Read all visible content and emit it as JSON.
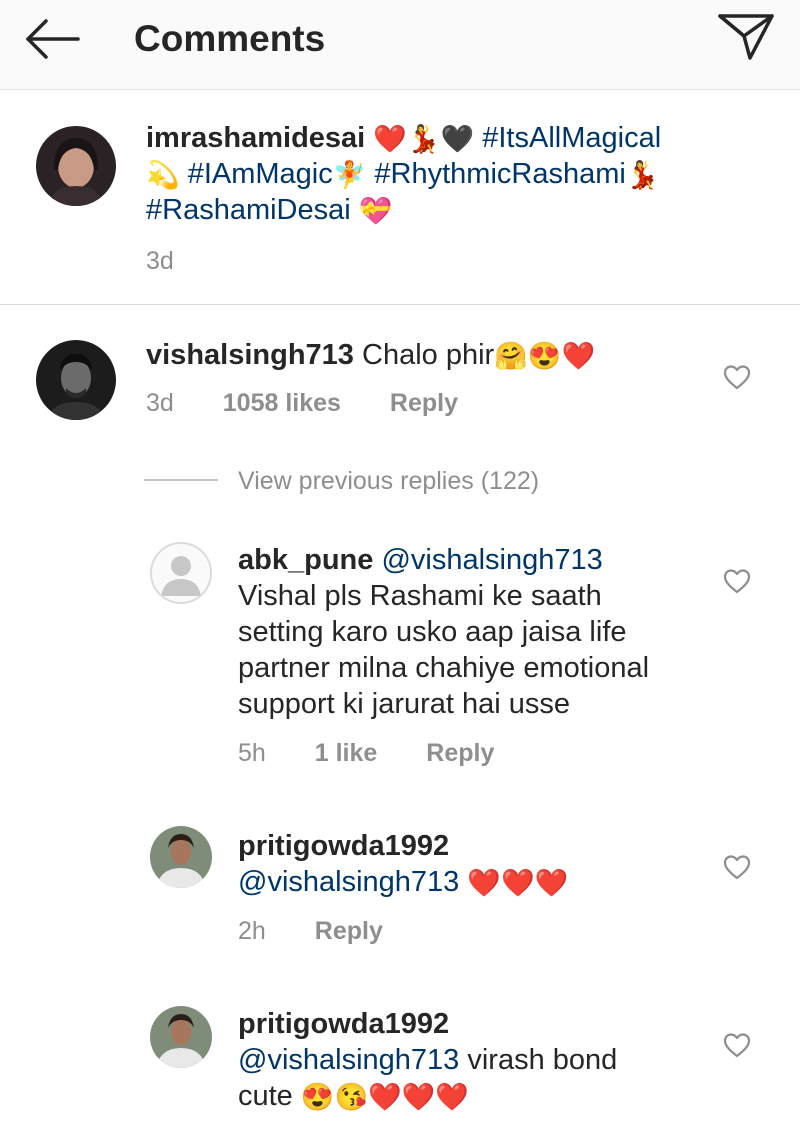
{
  "header": {
    "title": "Comments"
  },
  "caption": {
    "username": "imrashamidesai",
    "tags": [
      "#ItsAllMagical",
      "#IAmMagic",
      "#RhythmicRashami",
      "#RashamiDesai"
    ],
    "emoji": {
      "e1": "❤️",
      "e2": "💃",
      "e3": "🖤",
      "e4": "💫",
      "e5": "🧚",
      "e6": "💃",
      "e7": "💝"
    },
    "time": "3d"
  },
  "comment": {
    "username": "vishalsingh713",
    "text": "Chalo phir",
    "emoji": {
      "e1": "🤗",
      "e2": "😍",
      "e3": "❤️"
    },
    "time": "3d",
    "likes": "1058 likes",
    "reply": "Reply",
    "view_previous": "View previous replies (122)"
  },
  "replies": [
    {
      "username": "abk_pune",
      "mention": "@vishalsingh713",
      "lines": [
        "Vishal pls Rashami ke saath",
        "setting karo usko aap jaisa life",
        "partner milna chahiye emotional",
        "support ki jarurat hai usse"
      ],
      "time": "5h",
      "likes": "1 like",
      "reply": "Reply"
    },
    {
      "username": "pritigowda1992",
      "mention": "@vishalsingh713",
      "emoji": "❤️❤️❤️",
      "time": "2h",
      "reply": "Reply"
    },
    {
      "username": "pritigowda1992",
      "mention": "@vishalsingh713",
      "text": "virash bond",
      "text2": "cute",
      "emoji": "😍😘❤️❤️❤️"
    }
  ]
}
